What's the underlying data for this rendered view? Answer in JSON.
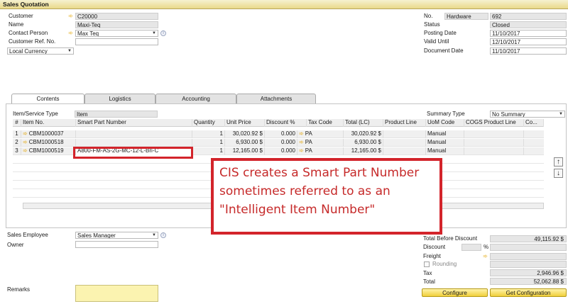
{
  "window": {
    "title": "Sales Quotation"
  },
  "header_left": {
    "customer_label": "Customer",
    "customer_value": "C20000",
    "name_label": "Name",
    "name_value": "Maxi-Teq",
    "contact_label": "Contact Person",
    "contact_value": "Max Teq",
    "ref_label": "Customer Ref. No.",
    "ref_value": "",
    "currency_value": "Local Currency"
  },
  "header_right": {
    "no_label": "No.",
    "series_value": "Hardware",
    "no_value": "692",
    "status_label": "Status",
    "status_value": "Closed",
    "posting_label": "Posting Date",
    "posting_value": "11/10/2017",
    "valid_label": "Valid Until",
    "valid_value": "12/10/2017",
    "docdate_label": "Document Date",
    "docdate_value": "11/10/2017"
  },
  "tabs": [
    "Contents",
    "Logistics",
    "Accounting",
    "Attachments"
  ],
  "contents": {
    "item_type_label": "Item/Service Type",
    "item_type_value": "Item",
    "summary_label": "Summary Type",
    "summary_value": "No Summary",
    "columns": [
      "#",
      "Item No.",
      "Smart Part Number",
      "Quantity",
      "Unit Price",
      "Discount %",
      "Tax Code",
      "Total (LC)",
      "Product Line",
      "UoM Code",
      "COGS Product Line",
      "Co..."
    ],
    "rows": [
      {
        "n": "1",
        "item": "CBM1000037",
        "smart": "",
        "qty": "1",
        "price": "30,020.92 $",
        "disc": "0.000",
        "tax": "PA",
        "total": "30,020.92 $",
        "pline": "",
        "uom": "Manual",
        "cogs": ""
      },
      {
        "n": "2",
        "item": "CBM1000518",
        "smart": "",
        "qty": "1",
        "price": "6,930.00 $",
        "disc": "0.000",
        "tax": "PA",
        "total": "6,930.00 $",
        "pline": "",
        "uom": "Manual",
        "cogs": ""
      },
      {
        "n": "3",
        "item": "CBM1000519",
        "smart": "A800-FM-AS-2G-MC-12-L-Bri-C",
        "qty": "1",
        "price": "12,165.00 $",
        "disc": "0.000",
        "tax": "PA",
        "total": "12,165.00 $",
        "pline": "",
        "uom": "Manual",
        "cogs": ""
      }
    ]
  },
  "callout": {
    "line1": "CIS creates a Smart Part Number",
    "line2": "sometimes referred to as an",
    "line3": "\"Intelligent Item Number\""
  },
  "footer_left": {
    "employee_label": "Sales Employee",
    "employee_value": "Sales Manager",
    "owner_label": "Owner",
    "owner_value": "",
    "remarks_label": "Remarks"
  },
  "footer_right": {
    "before_disc_label": "Total Before Discount",
    "before_disc_value": "49,115.92 $",
    "discount_label": "Discount",
    "discount_pct_symbol": "%",
    "freight_label": "Freight",
    "rounding_label": "Rounding",
    "tax_label": "Tax",
    "tax_value": "2,946.96 $",
    "total_label": "Total",
    "total_value": "52,062.88 $"
  },
  "buttons": {
    "configure": "Configure",
    "get_configuration": "Get Configuration"
  },
  "colors": {
    "callout_border": "#d3242b",
    "callout_text": "#c62a2a",
    "link_arrow": "#e3a400"
  }
}
